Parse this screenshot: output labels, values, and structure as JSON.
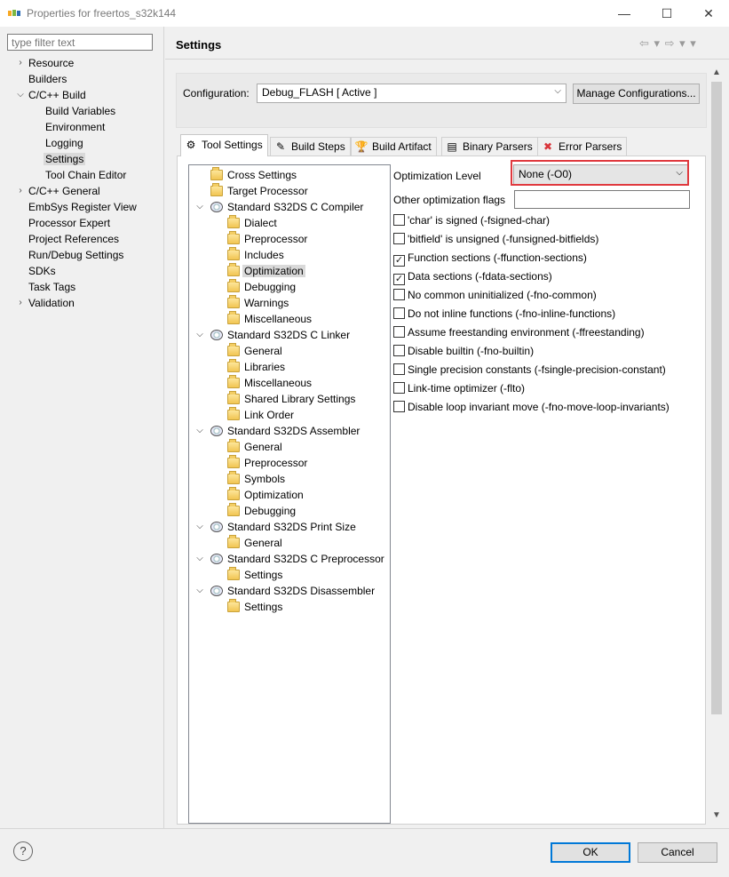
{
  "window": {
    "title": "Properties for freertos_s32k144",
    "minimize": "—",
    "maximize": "☐",
    "close": "✕"
  },
  "filter": {
    "placeholder": "type filter text"
  },
  "nav": [
    {
      "label": "Resource",
      "level": 0,
      "arrow": ">"
    },
    {
      "label": "Builders",
      "level": 0,
      "arrow": ""
    },
    {
      "label": "C/C++ Build",
      "level": 0,
      "arrow": "v"
    },
    {
      "label": "Build Variables",
      "level": 1,
      "arrow": ""
    },
    {
      "label": "Environment",
      "level": 1,
      "arrow": ""
    },
    {
      "label": "Logging",
      "level": 1,
      "arrow": ""
    },
    {
      "label": "Settings",
      "level": 1,
      "arrow": "",
      "selected": true
    },
    {
      "label": "Tool Chain Editor",
      "level": 1,
      "arrow": ""
    },
    {
      "label": "C/C++ General",
      "level": 0,
      "arrow": ">"
    },
    {
      "label": "EmbSys Register View",
      "level": 0,
      "arrow": ""
    },
    {
      "label": "Processor Expert",
      "level": 0,
      "arrow": ""
    },
    {
      "label": "Project References",
      "level": 0,
      "arrow": ""
    },
    {
      "label": "Run/Debug Settings",
      "level": 0,
      "arrow": ""
    },
    {
      "label": "SDKs",
      "level": 0,
      "arrow": ""
    },
    {
      "label": "Task Tags",
      "level": 0,
      "arrow": ""
    },
    {
      "label": "Validation",
      "level": 0,
      "arrow": ">"
    }
  ],
  "header": {
    "title": "Settings",
    "nav_buttons": "⇦ ▾ ⇨ ▾ ▾"
  },
  "config": {
    "label": "Configuration:",
    "value": "Debug_FLASH  [ Active ]",
    "manage_label": "Manage Configurations..."
  },
  "tabs": [
    {
      "label": "Tool Settings",
      "icon": "gear-icon",
      "glyph": "⚙",
      "active": true
    },
    {
      "label": "Build Steps",
      "icon": "hammer-icon",
      "glyph": "✎"
    },
    {
      "label": "Build Artifact",
      "icon": "trophy-icon",
      "glyph": "🏆"
    },
    {
      "label": "Binary Parsers",
      "icon": "binary-icon",
      "glyph": "▤"
    },
    {
      "label": "Error Parsers",
      "icon": "error-icon",
      "glyph": "✖"
    }
  ],
  "tool_tree": [
    {
      "label": "Cross Settings",
      "level": 0,
      "icon": "folder"
    },
    {
      "label": "Target Processor",
      "level": 0,
      "icon": "folder"
    },
    {
      "label": "Standard S32DS C Compiler",
      "level": 0,
      "icon": "gear",
      "expanded": true
    },
    {
      "label": "Dialect",
      "level": 1,
      "icon": "folder"
    },
    {
      "label": "Preprocessor",
      "level": 1,
      "icon": "folder"
    },
    {
      "label": "Includes",
      "level": 1,
      "icon": "folder"
    },
    {
      "label": "Optimization",
      "level": 1,
      "icon": "folder",
      "selected": true
    },
    {
      "label": "Debugging",
      "level": 1,
      "icon": "folder"
    },
    {
      "label": "Warnings",
      "level": 1,
      "icon": "folder"
    },
    {
      "label": "Miscellaneous",
      "level": 1,
      "icon": "folder"
    },
    {
      "label": "Standard S32DS C Linker",
      "level": 0,
      "icon": "gear",
      "expanded": true
    },
    {
      "label": "General",
      "level": 1,
      "icon": "folder"
    },
    {
      "label": "Libraries",
      "level": 1,
      "icon": "folder"
    },
    {
      "label": "Miscellaneous",
      "level": 1,
      "icon": "folder"
    },
    {
      "label": "Shared Library Settings",
      "level": 1,
      "icon": "folder"
    },
    {
      "label": "Link Order",
      "level": 1,
      "icon": "folder"
    },
    {
      "label": "Standard S32DS Assembler",
      "level": 0,
      "icon": "gear",
      "expanded": true
    },
    {
      "label": "General",
      "level": 1,
      "icon": "folder"
    },
    {
      "label": "Preprocessor",
      "level": 1,
      "icon": "folder"
    },
    {
      "label": "Symbols",
      "level": 1,
      "icon": "folder"
    },
    {
      "label": "Optimization",
      "level": 1,
      "icon": "folder"
    },
    {
      "label": "Debugging",
      "level": 1,
      "icon": "folder"
    },
    {
      "label": "Standard S32DS Print Size",
      "level": 0,
      "icon": "gear",
      "expanded": true
    },
    {
      "label": "General",
      "level": 1,
      "icon": "folder"
    },
    {
      "label": "Standard S32DS C Preprocessor",
      "level": 0,
      "icon": "gear",
      "expanded": true
    },
    {
      "label": "Settings",
      "level": 1,
      "icon": "folder"
    },
    {
      "label": "Standard S32DS Disassembler",
      "level": 0,
      "icon": "gear",
      "expanded": true
    },
    {
      "label": "Settings",
      "level": 1,
      "icon": "folder"
    }
  ],
  "options": {
    "opt_level_label": "Optimization Level",
    "opt_level_value": "None (-O0)",
    "other_flags_label": "Other optimization flags",
    "other_flags_value": "",
    "checkboxes": [
      {
        "label": "'char' is signed (-fsigned-char)",
        "checked": false
      },
      {
        "label": "'bitfield' is unsigned (-funsigned-bitfields)",
        "checked": false
      },
      {
        "label": "Function sections (-ffunction-sections)",
        "checked": true
      },
      {
        "label": "Data sections (-fdata-sections)",
        "checked": true
      },
      {
        "label": "No common uninitialized (-fno-common)",
        "checked": false
      },
      {
        "label": "Do not inline functions (-fno-inline-functions)",
        "checked": false
      },
      {
        "label": "Assume freestanding environment (-ffreestanding)",
        "checked": false
      },
      {
        "label": "Disable builtin (-fno-builtin)",
        "checked": false
      },
      {
        "label": "Single precision constants (-fsingle-precision-constant)",
        "checked": false
      },
      {
        "label": "Link-time optimizer (-flto)",
        "checked": false
      },
      {
        "label": "Disable loop invariant move (-fno-move-loop-invariants)",
        "checked": false
      }
    ]
  },
  "footer": {
    "help": "?",
    "ok_label": "OK",
    "cancel_label": "Cancel"
  },
  "colors": {
    "highlight": "#e0393e",
    "default_button": "#0078d7"
  }
}
